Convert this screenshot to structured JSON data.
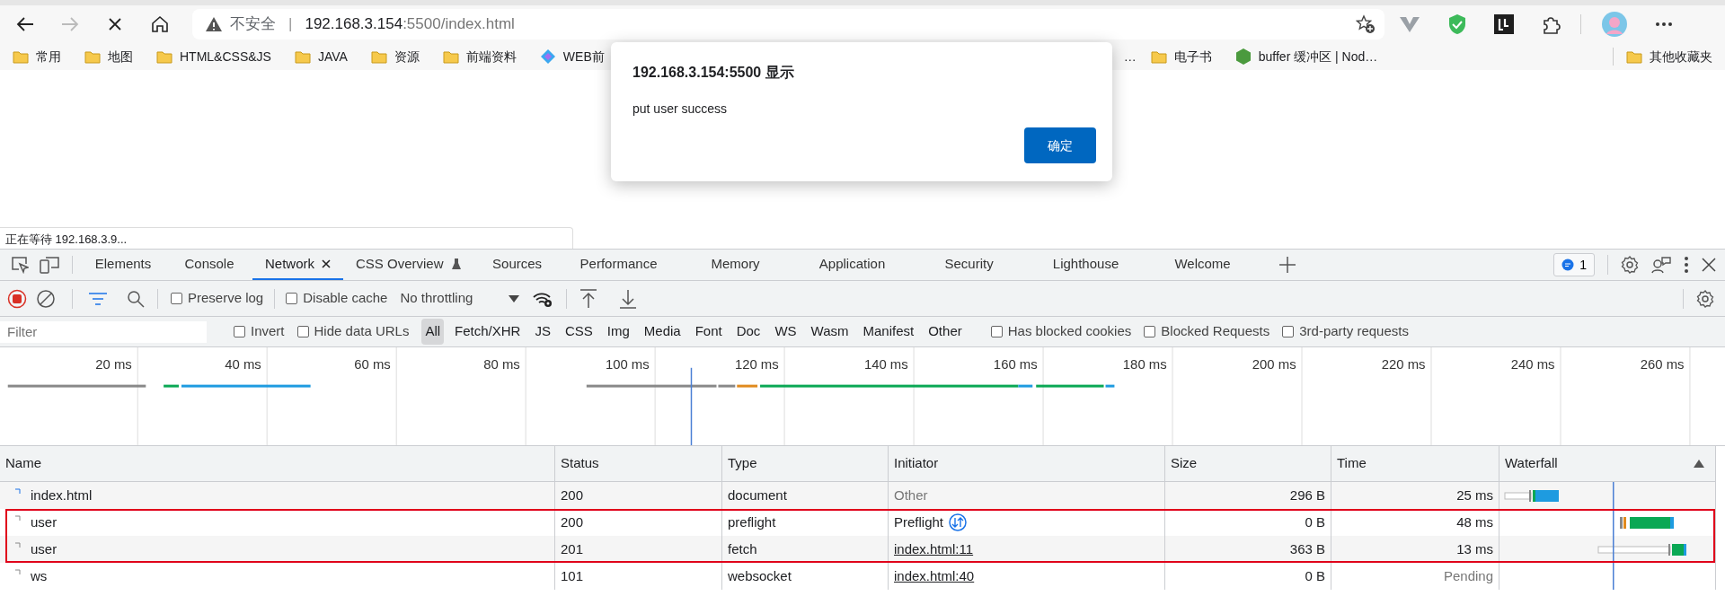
{
  "browser": {
    "forward_disabled": true,
    "loading": true,
    "security_label": "不安全",
    "separator": "|",
    "url_host": "192.168.3.154",
    "url_rest": ":5500/index.html",
    "bookmarks": [
      {
        "label": "常用",
        "kind": "folder"
      },
      {
        "label": "地图",
        "kind": "folder"
      },
      {
        "label": "HTML&CSS&JS",
        "kind": "folder"
      },
      {
        "label": "JAVA",
        "kind": "folder"
      },
      {
        "label": "资源",
        "kind": "folder"
      },
      {
        "label": "前端资料",
        "kind": "folder"
      },
      {
        "label": "WEB前",
        "kind": "site"
      },
      {
        "label": "…",
        "kind": "text"
      },
      {
        "label": "电子书",
        "kind": "folder"
      },
      {
        "label": "buffer 缓冲区 | Nod…",
        "kind": "node"
      }
    ],
    "other_bookmarks": "其他收藏夹"
  },
  "dialog": {
    "title": "192.168.3.154:5500 显示",
    "message": "put user success",
    "button": "确定"
  },
  "status_text": "正在等待 192.168.3.9...",
  "devtools": {
    "tabs": [
      {
        "label": "Elements",
        "selected": false,
        "closable": false,
        "experimental": false
      },
      {
        "label": "Console",
        "selected": false,
        "closable": false,
        "experimental": false
      },
      {
        "label": "Network",
        "selected": true,
        "closable": true,
        "experimental": false
      },
      {
        "label": "CSS Overview",
        "selected": false,
        "closable": false,
        "experimental": true
      },
      {
        "label": "Sources",
        "selected": false,
        "closable": false,
        "experimental": false
      },
      {
        "label": "Performance",
        "selected": false,
        "closable": false,
        "experimental": false
      },
      {
        "label": "Memory",
        "selected": false,
        "closable": false,
        "experimental": false
      },
      {
        "label": "Application",
        "selected": false,
        "closable": false,
        "experimental": false
      },
      {
        "label": "Security",
        "selected": false,
        "closable": false,
        "experimental": false
      },
      {
        "label": "Lighthouse",
        "selected": false,
        "closable": false,
        "experimental": false
      },
      {
        "label": "Welcome",
        "selected": false,
        "closable": false,
        "experimental": false
      }
    ],
    "issues_badge": "1",
    "toolbar": {
      "recording": true,
      "preserve_log": {
        "label": "Preserve log",
        "checked": false
      },
      "disable_cache": {
        "label": "Disable cache",
        "checked": false
      },
      "throttling": "No throttling"
    },
    "filter": {
      "placeholder": "Filter",
      "invert": {
        "label": "Invert",
        "checked": false
      },
      "hide_data_urls": {
        "label": "Hide data URLs",
        "checked": false
      },
      "types": [
        {
          "label": "All",
          "selected": true
        },
        {
          "label": "Fetch/XHR",
          "selected": false
        },
        {
          "label": "JS",
          "selected": false
        },
        {
          "label": "CSS",
          "selected": false
        },
        {
          "label": "Img",
          "selected": false
        },
        {
          "label": "Media",
          "selected": false
        },
        {
          "label": "Font",
          "selected": false
        },
        {
          "label": "Doc",
          "selected": false
        },
        {
          "label": "WS",
          "selected": false
        },
        {
          "label": "Wasm",
          "selected": false
        },
        {
          "label": "Manifest",
          "selected": false
        },
        {
          "label": "Other",
          "selected": false
        }
      ],
      "checks": [
        {
          "label": "Has blocked cookies",
          "checked": false
        },
        {
          "label": "Blocked Requests",
          "checked": false
        },
        {
          "label": "3rd-party requests",
          "checked": false
        }
      ]
    },
    "overview": {
      "ticks": [
        "20 ms",
        "40 ms",
        "60 ms",
        "80 ms",
        "100 ms",
        "120 ms",
        "140 ms",
        "160 ms",
        "180 ms",
        "200 ms",
        "220 ms",
        "240 ms",
        "260 ms"
      ]
    },
    "table": {
      "columns": [
        "Name",
        "Status",
        "Type",
        "Initiator",
        "Size",
        "Time",
        "Waterfall"
      ],
      "rows": [
        {
          "name": "index.html",
          "status": "200",
          "type": "document",
          "initiator": {
            "text": "Other",
            "kind": "plain"
          },
          "size": "296 B",
          "time": "25 ms",
          "pending": false,
          "highlighted": false
        },
        {
          "name": "user",
          "status": "200",
          "type": "preflight",
          "initiator": {
            "text": "Preflight",
            "kind": "preflight"
          },
          "size": "0 B",
          "time": "48 ms",
          "pending": false,
          "highlighted": true
        },
        {
          "name": "user",
          "status": "201",
          "type": "fetch",
          "initiator": {
            "text": "index.html:11",
            "kind": "link"
          },
          "size": "363 B",
          "time": "13 ms",
          "pending": false,
          "highlighted": true
        },
        {
          "name": "ws",
          "status": "101",
          "type": "websocket",
          "initiator": {
            "text": "index.html:40",
            "kind": "link"
          },
          "size": "0 B",
          "time": "Pending",
          "pending": true,
          "highlighted": false
        }
      ]
    }
  }
}
